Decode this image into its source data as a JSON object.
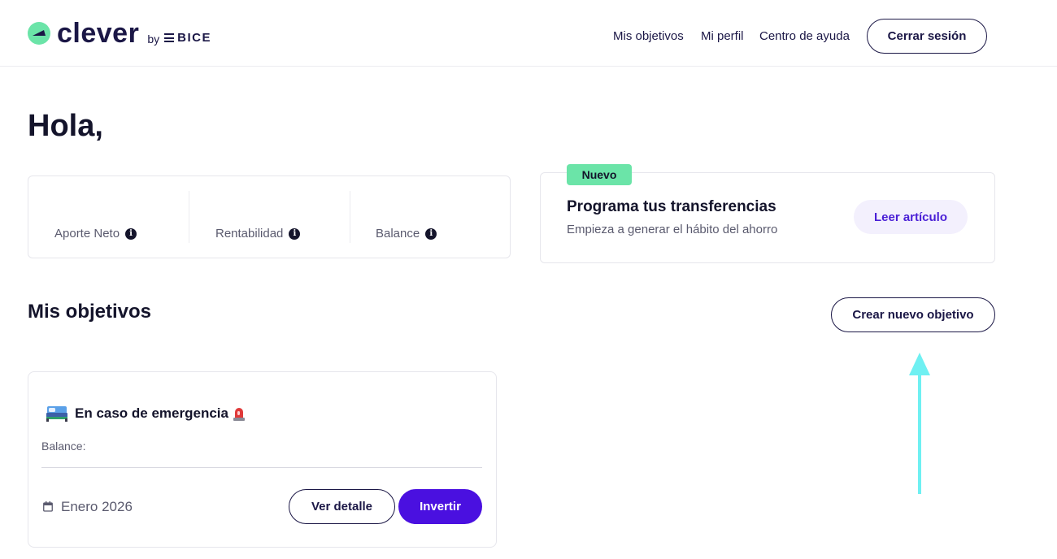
{
  "header": {
    "logo": {
      "word": "clever",
      "by": "by",
      "brand": "BICE"
    },
    "nav": [
      {
        "label": "Mis objetivos"
      },
      {
        "label": "Mi perfil"
      },
      {
        "label": "Centro de ayuda"
      }
    ],
    "logout_label": "Cerrar sesión"
  },
  "greeting": "Hola,",
  "stats": [
    {
      "label": "Aporte Neto",
      "icon": "info-icon"
    },
    {
      "label": "Rentabilidad",
      "icon": "info-icon"
    },
    {
      "label": "Balance",
      "icon": "info-icon"
    }
  ],
  "promo": {
    "badge": "Nuevo",
    "title": "Programa tus transferencias",
    "subtitle": "Empieza a generar el hábito del ahorro",
    "button_label": "Leer artículo"
  },
  "objectives": {
    "title": "Mis objetivos",
    "create_label": "Crear nuevo objetivo",
    "goals": [
      {
        "title": "En caso de emergencia",
        "icon": "bed-icon",
        "emoji_icon": "siren-icon",
        "balance_label": "Balance:",
        "date": "Enero 2026",
        "detail_label": "Ver detalle",
        "invest_label": "Invertir"
      }
    ]
  },
  "colors": {
    "primary": "#4a10e0",
    "accent_green": "#6be4a8",
    "navy": "#1b1746",
    "annotation_arrow": "#6ff0f2"
  }
}
